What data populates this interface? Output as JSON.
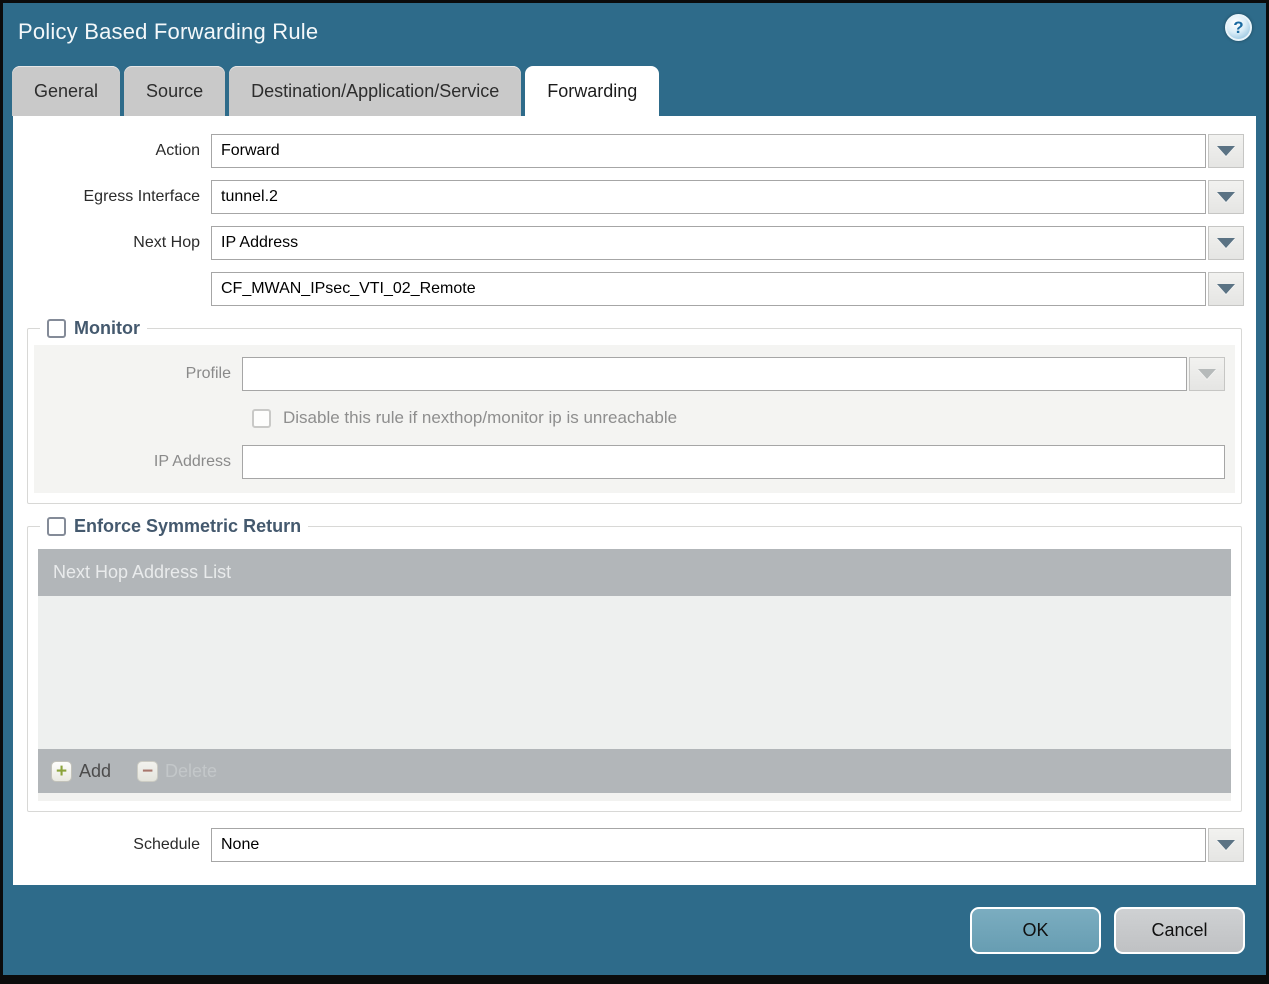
{
  "dialog": {
    "title": "Policy Based Forwarding Rule"
  },
  "icons": {
    "help": "?",
    "add_plus": "+",
    "delete_minus": "−"
  },
  "tabs": [
    {
      "label": "General",
      "active": false
    },
    {
      "label": "Source",
      "active": false
    },
    {
      "label": "Destination/Application/Service",
      "active": false
    },
    {
      "label": "Forwarding",
      "active": true
    }
  ],
  "form": {
    "action": {
      "label": "Action",
      "value": "Forward"
    },
    "egress_interface": {
      "label": "Egress Interface",
      "value": "tunnel.2"
    },
    "next_hop": {
      "label": "Next Hop",
      "value": "IP Address"
    },
    "next_hop_address": {
      "value": "CF_MWAN_IPsec_VTI_02_Remote"
    },
    "schedule": {
      "label": "Schedule",
      "value": "None"
    }
  },
  "monitor": {
    "legend": "Monitor",
    "checked": false,
    "profile": {
      "label": "Profile",
      "value": ""
    },
    "disable_checkbox_label": "Disable this rule if nexthop/monitor ip is unreachable",
    "disable_checked": false,
    "ip_address": {
      "label": "IP Address",
      "value": ""
    }
  },
  "symmetric_return": {
    "legend": "Enforce Symmetric Return",
    "checked": false,
    "table_header": "Next Hop Address List",
    "rows": [],
    "add_label": "Add",
    "delete_label": "Delete",
    "delete_enabled": false
  },
  "footer": {
    "ok_label": "OK",
    "cancel_label": "Cancel"
  },
  "colors": {
    "chrome": "#2e6b8a",
    "tab_inactive": "#c9c9c9",
    "table_bar": "#b2b6b9",
    "profile_disabled_bg": "#f3eedc",
    "ok_button": "#6fa6ba",
    "cancel_button": "#c7c9cb"
  }
}
